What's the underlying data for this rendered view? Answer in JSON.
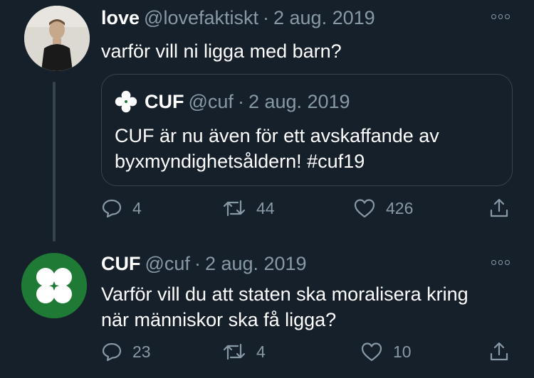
{
  "tweets": [
    {
      "name": "love",
      "handle": "@lovefaktiskt",
      "separator": "·",
      "date": "2 aug. 2019",
      "text": "varför vill ni ligga med barn?",
      "avatar_icon": "person-photo",
      "quoted": {
        "name": "CUF",
        "handle": "@cuf",
        "separator": "·",
        "date": "2 aug. 2019",
        "text_lines": [
          "CUF är nu även för ett avskaffande av",
          "byxmyndighetsåldern! #cuf19"
        ],
        "logo_icon": "four-leaf-clover-icon"
      },
      "actions": {
        "replies": "4",
        "retweets": "44",
        "likes": "426"
      }
    },
    {
      "name": "CUF",
      "handle": "@cuf",
      "separator": "·",
      "date": "2 aug. 2019",
      "text_lines": [
        "Varför vill du att staten ska moralisera kring",
        "när människor ska få ligga?"
      ],
      "avatar_icon": "four-leaf-clover-icon",
      "actions": {
        "replies": "23",
        "retweets": "4",
        "likes": "10"
      }
    }
  ],
  "colors": {
    "background": "#15202b",
    "text": "#ffffff",
    "muted": "#8899a6",
    "border": "#38444d",
    "cuf_green": "#1e7a34"
  }
}
